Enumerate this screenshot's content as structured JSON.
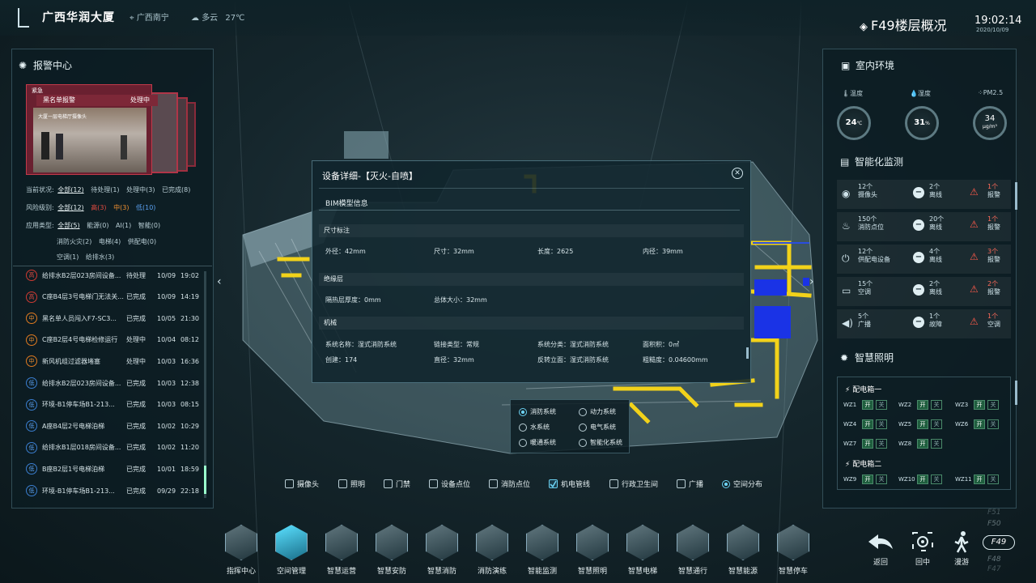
{
  "header": {
    "title": "广西华润大厦",
    "location": "广西南宁",
    "weather": "多云",
    "temperature": "27℃",
    "floor_overview": "F49楼层概况",
    "time": "19:02:14",
    "date": "2020/10/09"
  },
  "alarm_center": {
    "title": "报警中心",
    "cam_tag": "紧急",
    "cam_title": "黑名单报警",
    "cam_status": "处理中",
    "cam_caption": "大厦一层电梯厅摄像头",
    "filters": {
      "status_label": "当前状况:",
      "status_options": [
        "全部(12)",
        "待处理(1)",
        "处理中(3)",
        "已完成(8)"
      ],
      "risk_label": "风险级别:",
      "risk_options": [
        "全部(12)",
        "高(3)",
        "中(3)",
        "低(10)"
      ],
      "type_label": "应用类型:",
      "type_row1": [
        "全部(5)",
        "能源(0)",
        "AI(1)",
        "智能(0)"
      ],
      "type_row2": [
        "消防火灾(2)",
        "电梯(4)",
        "供配电(0)"
      ],
      "type_row3": [
        "空调(1)",
        "给排水(3)"
      ]
    },
    "list": [
      {
        "level": "高",
        "text": "给排水B2层023房间设备...",
        "status": "待处理",
        "date": "10/09",
        "time": "19:02"
      },
      {
        "level": "高",
        "text": "C座B4层3号电梯门无法关...",
        "status": "已完成",
        "date": "10/09",
        "time": "14:19"
      },
      {
        "level": "中",
        "text": "黑名单人员闯入F7-SC3...",
        "status": "已完成",
        "date": "10/05",
        "time": "21:30"
      },
      {
        "level": "中",
        "text": "C座B2层4号电梯检修运行",
        "status": "处理中",
        "date": "10/04",
        "time": "08:12"
      },
      {
        "level": "中",
        "text": "新风机组过滤器堵塞",
        "status": "处理中",
        "date": "10/03",
        "time": "16:36"
      },
      {
        "level": "低",
        "text": "给排水B2层023房间设备...",
        "status": "已完成",
        "date": "10/03",
        "time": "12:38"
      },
      {
        "level": "低",
        "text": "环境-B1停车场B1-213...",
        "status": "已完成",
        "date": "10/03",
        "time": "08:15"
      },
      {
        "level": "低",
        "text": "A座B4层2号电梯泊梯",
        "status": "已完成",
        "date": "10/02",
        "time": "10:29"
      },
      {
        "level": "低",
        "text": "给排水B1层018房间设备...",
        "status": "已完成",
        "date": "10/02",
        "time": "11:20"
      },
      {
        "level": "低",
        "text": "B座B2层1号电梯泊梯",
        "status": "已完成",
        "date": "10/01",
        "time": "18:59"
      },
      {
        "level": "低",
        "text": "环境-B1停车场B1-213...",
        "status": "已完成",
        "date": "09/29",
        "time": "22:18"
      }
    ]
  },
  "indoor": {
    "title": "室内环境",
    "temp_label": "温度",
    "temp_value": "24",
    "temp_unit": "℃",
    "humid_label": "湿度",
    "humid_value": "31",
    "humid_unit": "%",
    "pm_label": "PM2.5",
    "pm_value": "34",
    "pm_unit": "μg/m³"
  },
  "monitor": {
    "title": "智能化监测",
    "rows": [
      {
        "a_num": "12个",
        "a_label": "摄像头",
        "b_num": "2个",
        "b_label": "离线",
        "c_num": "1个",
        "c_label": "报警"
      },
      {
        "a_num": "150个",
        "a_label": "消防点位",
        "b_num": "20个",
        "b_label": "离线",
        "c_num": "1个",
        "c_label": "报警"
      },
      {
        "a_num": "12个",
        "a_label": "供配电设备",
        "b_num": "4个",
        "b_label": "离线",
        "c_num": "3个",
        "c_label": "报警"
      },
      {
        "a_num": "15个",
        "a_label": "空调",
        "b_num": "2个",
        "b_label": "离线",
        "c_num": "2个",
        "c_label": "报警"
      },
      {
        "a_num": "5个",
        "a_label": "广播",
        "b_num": "1个",
        "b_label": "故障",
        "c_num": "1个",
        "c_label": "空调"
      }
    ]
  },
  "lighting": {
    "title": "智慧照明",
    "box1": "配电箱一",
    "box2": "配电箱二",
    "on": "开",
    "off": "关",
    "rows1": [
      [
        "WZ1",
        "WZ2",
        "WZ3"
      ],
      [
        "WZ4",
        "WZ5",
        "WZ6"
      ],
      [
        "WZ7",
        "WZ8"
      ]
    ],
    "rows2": [
      [
        "WZ9",
        "WZ10",
        "WZ11"
      ]
    ]
  },
  "dialog": {
    "title": "设备详细-【灭火-自喷】",
    "tab": "BIM模型信息",
    "sec1": "尺寸标注",
    "outer": "外径：42mm",
    "size": "尺寸：32mm",
    "length": "长度：2625",
    "inner": "内径：39mm",
    "sec2": "绝缘层",
    "insul": "隔热层厚度：0mm",
    "total": "总体大小：32mm",
    "sec3": "机械",
    "sysname": "系统名称：湿式消防系统",
    "linktype": "链接类型：常规",
    "syscat": "系统分类：湿式消防系统",
    "area": "面积积：0㎡",
    "create": "创建：174",
    "diam": "直径：32mm",
    "reverse": "反转立面：湿式消防系统",
    "rough": "粗糙度：0.04600mm"
  },
  "systems": [
    "消防系统",
    "动力系统",
    "水系统",
    "电气系统",
    "暖通系统",
    "智能化系统"
  ],
  "layers": [
    "摄像头",
    "照明",
    "门禁",
    "设备点位",
    "消防点位",
    "机电管线",
    "行政卫生间",
    "广播",
    "空间分布"
  ],
  "nav": [
    "指挥中心",
    "空间管理",
    "智慧运营",
    "智慧安防",
    "智慧消防",
    "消防演练",
    "智能监测",
    "智慧照明",
    "智慧电梯",
    "智慧通行",
    "智慧能源",
    "智慧停车"
  ],
  "right_buttons": [
    "返回",
    "回中",
    "漫游"
  ],
  "floors": [
    "F51",
    "F50",
    "F49",
    "F48",
    "F47"
  ],
  "colors": {
    "accent": "#5ae0ff",
    "alarm_high": "#e04a40",
    "alarm_mid": "#f09030",
    "alarm_low": "#5aa0f0",
    "pipe_yellow": "#f2d21a",
    "pipe_blue": "#1a33e6"
  }
}
